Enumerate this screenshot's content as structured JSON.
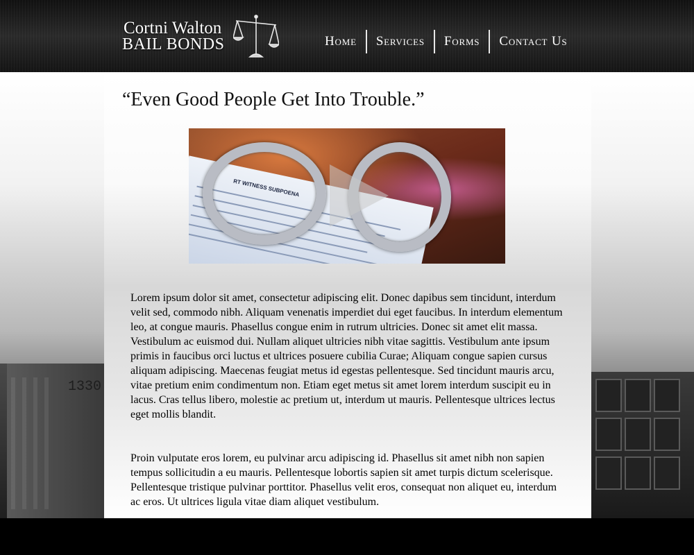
{
  "header": {
    "logo": {
      "line1": "Cortni Walton",
      "line2": "BAIL BONDS"
    },
    "nav": [
      {
        "label": "Home"
      },
      {
        "label": "Services"
      },
      {
        "label": "Forms"
      },
      {
        "label": "Contact Us"
      }
    ]
  },
  "main": {
    "tagline": "“Even Good People Get Into Trouble.”",
    "video": {
      "document_text": "RT WITNESS SUBPOENA"
    },
    "paragraphs": [
      " Lorem ipsum dolor sit amet, consectetur adipiscing elit. Donec dapibus sem tincidunt, interdum velit sed, commodo nibh. Aliquam venenatis imperdiet dui eget faucibus. In interdum elementum leo, at congue mauris. Phasellus congue enim in rutrum ultricies. Donec sit amet elit massa. Vestibulum ac euismod dui. Nullam aliquet ultricies nibh vitae sagittis. Vestibulum ante ipsum primis in faucibus orci luctus et ultrices posuere cubilia Curae; Aliquam congue sapien cursus aliquam adipiscing. Maecenas feugiat metus id egestas pellentesque. Sed tincidunt mauris arcu, vitae pretium enim condimentum non. Etiam eget metus sit amet lorem interdum suscipit eu in lacus. Cras tellus libero, molestie ac pretium ut, interdum ut mauris. Pellentesque ultrices lectus eget mollis blandit.",
      "Proin vulputate eros lorem, eu pulvinar arcu adipiscing id. Phasellus sit amet nibh non sapien tempus sollicitudin a eu mauris. Pellentesque lobortis sapien sit amet turpis dictum scelerisque. Pellentesque tristique pulvinar porttitor. Phasellus velit eros, consequat non aliquet eu, interdum ac eros. Ut ultrices ligula vitae diam aliquet vestibulum."
    ]
  },
  "background": {
    "building_number": "1330"
  },
  "colors": {
    "header_bg": "#1e1e1e",
    "footer_bg": "#000000",
    "nav_text": "#ffffff"
  },
  "icons": {
    "logo": "scales-of-justice-icon",
    "video": "play-icon"
  }
}
